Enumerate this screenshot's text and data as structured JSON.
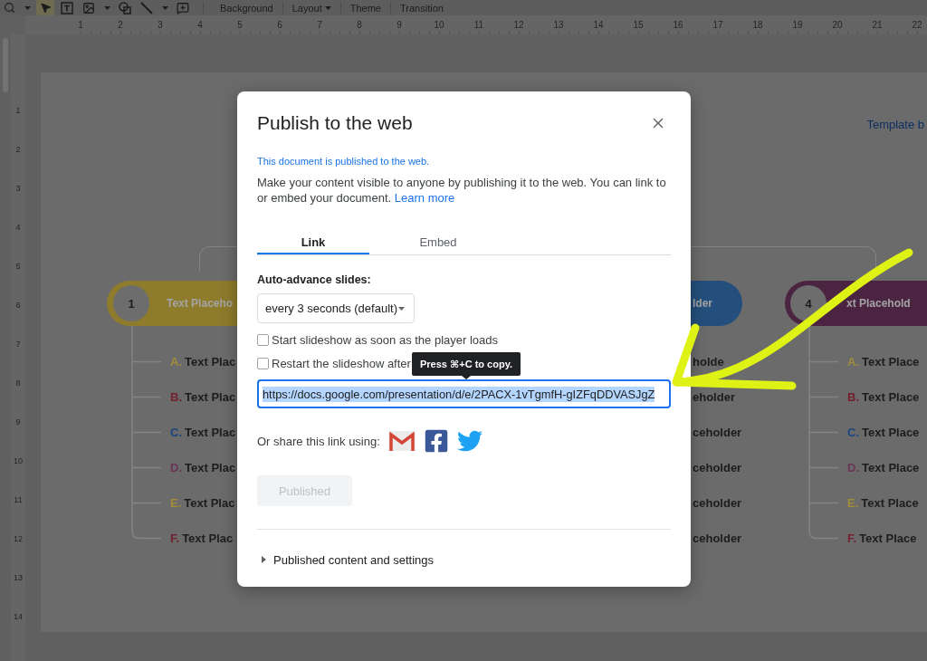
{
  "toolbar": {
    "tools": [
      {
        "kind": "zoom",
        "selected": false
      },
      {
        "kind": "dropdown",
        "selected": false
      },
      {
        "kind": "pointer",
        "selected": true
      },
      {
        "kind": "textbox",
        "selected": false
      },
      {
        "kind": "image",
        "selected": false
      },
      {
        "kind": "dropdown",
        "selected": false
      },
      {
        "kind": "shape",
        "selected": false
      },
      {
        "kind": "line",
        "selected": false
      },
      {
        "kind": "dropdown",
        "selected": false
      },
      {
        "kind": "comment",
        "selected": false
      }
    ],
    "menus": [
      {
        "label": "Background",
        "dropdown": false
      },
      {
        "label": "Layout",
        "dropdown": true
      },
      {
        "label": "Theme",
        "dropdown": false
      },
      {
        "label": "Transition",
        "dropdown": false
      }
    ]
  },
  "rulers": {
    "horizontal": [
      "1",
      "2",
      "3",
      "4",
      "5",
      "6",
      "7",
      "8",
      "9",
      "10",
      "11",
      "12",
      "13",
      "14",
      "15",
      "16",
      "17",
      "18",
      "19",
      "20",
      "21",
      "22"
    ],
    "vertical": [
      "1",
      "2",
      "3",
      "4",
      "5",
      "6",
      "7",
      "8",
      "9",
      "10",
      "11",
      "12",
      "13",
      "14"
    ]
  },
  "slide": {
    "header": "Template b",
    "branches": [
      {
        "kind": "start",
        "number": "1",
        "color": "#8e7b2c",
        "title": "Text Placeho",
        "items": [
          {
            "letter": "A.",
            "color": "#a08c3a",
            "text": "Text Plac"
          },
          {
            "letter": "B.",
            "color": "#74202c",
            "text": "Text Plac"
          },
          {
            "letter": "C.",
            "color": "#1a4580",
            "text": "Text Plac"
          },
          {
            "letter": "D.",
            "color": "#6a3658",
            "text": "Text Plac"
          },
          {
            "letter": "E.",
            "color": "#a08c3a",
            "text": "Text Plac"
          },
          {
            "letter": "F.",
            "color": "#74202c",
            "text": "Text Plac"
          }
        ]
      },
      {
        "kind": "middle",
        "color": "#244f7c",
        "title": "lder",
        "items": [
          {
            "text": "holde"
          },
          {
            "text": "eholder"
          },
          {
            "text": "ceholder"
          },
          {
            "text": "ceholder"
          },
          {
            "text": "ceholder"
          },
          {
            "text": "ceholder"
          }
        ]
      },
      {
        "kind": "end",
        "number": "4",
        "color": "#4b2442",
        "title": "xt Placehold",
        "items": [
          {
            "letter": "A.",
            "color": "#a08c3a",
            "text": "Text Place"
          },
          {
            "letter": "B.",
            "color": "#74202c",
            "text": "Text Place"
          },
          {
            "letter": "C.",
            "color": "#1a4580",
            "text": "Text Place"
          },
          {
            "letter": "D.",
            "color": "#6a3658",
            "text": "Text Place"
          },
          {
            "letter": "E.",
            "color": "#a08c3a",
            "text": "Text Place"
          },
          {
            "letter": "F.",
            "color": "#74202c",
            "text": "Text Place"
          }
        ]
      }
    ]
  },
  "dialog": {
    "title": "Publish to the web",
    "status": "This document is published to the web.",
    "description": "Make your content visible to anyone by publishing it to the web. You can link to or embed your document.",
    "learn_more": "Learn more",
    "tabs": [
      {
        "label": "Link",
        "selected": true
      },
      {
        "label": "Embed",
        "selected": false
      }
    ],
    "auto_advance": {
      "label": "Auto-advance slides:",
      "value": "every 3 seconds (default)"
    },
    "options": [
      {
        "label": "Start slideshow as soon as the player loads",
        "checked": false
      },
      {
        "label": "Restart the slideshow after",
        "checked": false
      }
    ],
    "tooltip": "Press ⌘+C to copy.",
    "link_field": {
      "value": "https://docs.google.com/presentation/d/e/2PACX-1vTgmfH-gIZFqDDVASJgZ",
      "text_selected": true
    },
    "share": {
      "label": "Or share this link using:",
      "services": [
        {
          "kind": "gmail"
        },
        {
          "kind": "facebook"
        },
        {
          "kind": "twitter"
        }
      ]
    },
    "publish_button": {
      "label": "Published",
      "disabled": true
    },
    "section": {
      "label": "Published content and settings",
      "expanded": false
    }
  }
}
